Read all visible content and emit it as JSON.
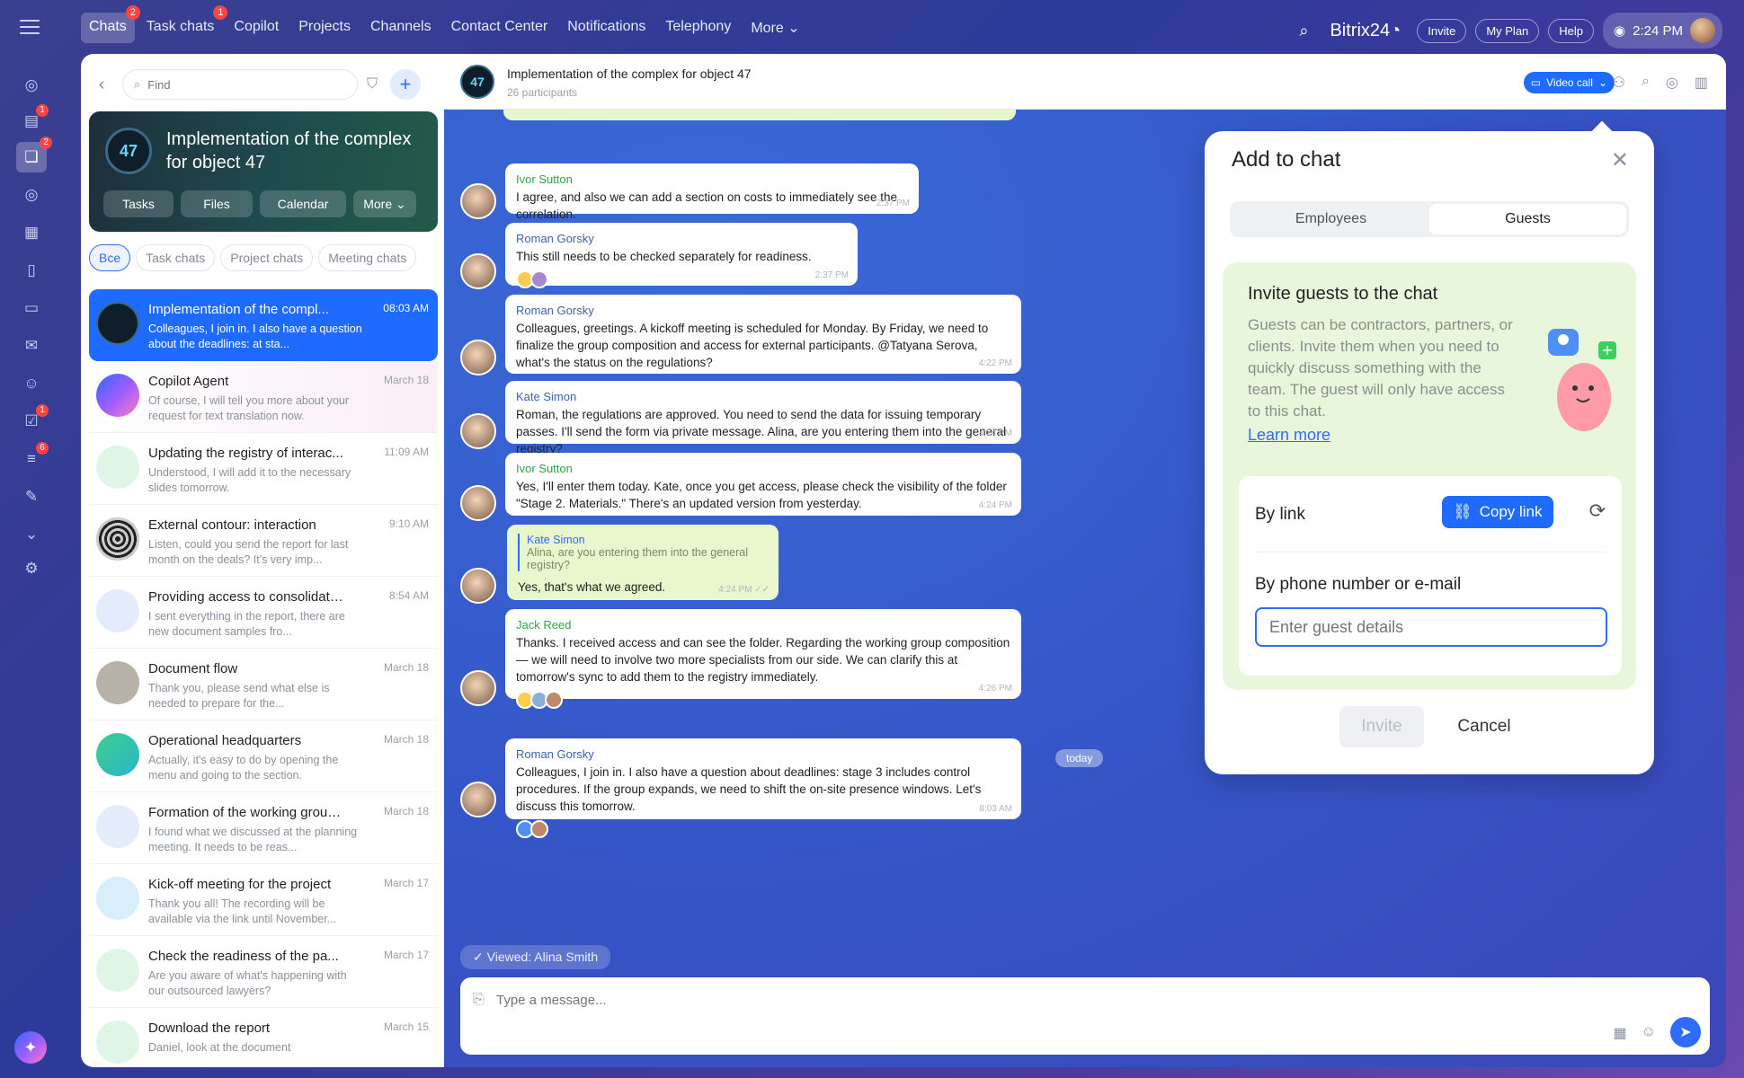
{
  "topbar": {
    "nav": [
      {
        "label": "Chats",
        "badge": "2"
      },
      {
        "label": "Task chats",
        "badge": "1"
      },
      {
        "label": "Copilot",
        "badge": ""
      },
      {
        "label": "Projects",
        "badge": ""
      },
      {
        "label": "Channels",
        "badge": ""
      },
      {
        "label": "Contact Center",
        "badge": ""
      },
      {
        "label": "Notifications",
        "badge": ""
      },
      {
        "label": "Telephony",
        "badge": ""
      },
      {
        "label": "More ⌄",
        "badge": ""
      }
    ],
    "brand": "Bitrix24",
    "invite": "Invite",
    "my_plan": "My Plan",
    "help": "Help",
    "time": "2:24 PM"
  },
  "rail": {
    "badges": [
      "1",
      "2",
      "1",
      "6"
    ]
  },
  "left": {
    "search_placeholder": "Find",
    "hero_title": "Implementation of the complex for object 47",
    "hero_buttons": [
      "Tasks",
      "Files",
      "Calendar",
      "More ⌄"
    ],
    "filters": [
      "Все",
      "Task chats",
      "Project chats",
      "Meeting chats"
    ],
    "chats": [
      {
        "name": "Implementation of the compl...",
        "time": "08:03 AM",
        "preview": "Colleagues, I join in. I also have a question about the deadlines: at sta..."
      },
      {
        "name": "Copilot Agent",
        "time": "March 18",
        "preview": "Of course, I will tell you more about your request for text translation now."
      },
      {
        "name": "Updating the registry of interac...",
        "time": "11:09 AM",
        "preview": "Understood, I will add it to the necessary slides tomorrow."
      },
      {
        "name": "External contour: interaction",
        "time": "9:10 AM",
        "preview": "Listen, could you send the report for last month on the deals? It's very imp..."
      },
      {
        "name": "Providing access to consolidate...",
        "time": "8:54 AM",
        "preview": "I sent everything in the report, there are new document samples fro..."
      },
      {
        "name": "Document flow",
        "time": "March 18",
        "preview": "Thank you, please send what else is needed to prepare for the..."
      },
      {
        "name": "Operational headquarters",
        "time": "March 18",
        "preview": "Actually, it's easy to do by opening the menu and going to the section."
      },
      {
        "name": "Formation of the working group...",
        "time": "March 18",
        "preview": "I found what we discussed at the planning meeting. It needs to be reas..."
      },
      {
        "name": "Kick-off meeting for the project",
        "time": "March 17",
        "preview": "Thank you all! The recording will be available via the link until November..."
      },
      {
        "name": "Check the readiness of the pa...",
        "time": "March 17",
        "preview": "Are you aware of what's happening with our outsourced lawyers?"
      },
      {
        "name": "Download the report",
        "time": "March 15",
        "preview": "Daniel, look at the document"
      }
    ]
  },
  "chat": {
    "title": "Implementation of the complex for object 47",
    "participants": "26 participants",
    "video_call": "Video call",
    "messages": [
      {
        "author": "Ivor Sutton",
        "text": "I agree, and also we can add a section on costs to immediately see the correlation.",
        "time": "2:37 PM"
      },
      {
        "author": "Roman Gorsky",
        "text": "This still needs to be checked separately for readiness.",
        "time": "2:37 PM"
      },
      {
        "author": "Roman Gorsky",
        "text": "Colleagues, greetings. A kickoff meeting is scheduled for Monday. By Friday, we need to finalize the group composition and access for external participants. @Tatyana Serova, what's the status on the regulations?",
        "time": "4:22 PM"
      },
      {
        "author": "Kate Simon",
        "text": "Roman, the regulations are approved. You need to send the data for issuing temporary passes. I'll send the form via private message. Alina, are you entering them into the general registry?",
        "time": "4:24 PM"
      },
      {
        "author": "Ivor Sutton",
        "text": "Yes, I'll enter them today. Kate, once you get access, please check the visibility of the folder \"Stage 2. Materials.\" There's an updated version from yesterday.",
        "time": "4:24 PM"
      },
      {
        "quote_author": "Kate Simon",
        "quote_text": "Alina, are you entering them into the general registry?",
        "text": "Yes, that's what we agreed.",
        "time": "4:24 PM"
      },
      {
        "author": "Jack Reed",
        "text": "Thanks. I received access and can see the folder. Regarding the working group composition — we will need to involve two more specialists from our side. We can clarify this at tomorrow's sync to add them to the registry immediately.",
        "time": "4:26 PM"
      },
      {
        "author": "Roman Gorsky",
        "text": "Colleagues, I join in. I also have a question about deadlines: stage 3 includes control procedures. If the group expands, we need to shift the on-site presence windows. Let's discuss this tomorrow.",
        "time": "8:03 AM"
      }
    ],
    "today": "today",
    "viewed": "Viewed: Alina Smith",
    "composer_placeholder": "Type a message..."
  },
  "dialog": {
    "title": "Add to chat",
    "tabs": [
      "Employees",
      "Guests"
    ],
    "invite_title": "Invite guests to the chat",
    "invite_desc": "Guests can be contractors, partners, or clients. Invite them when you need to quickly discuss something with the team. The guest will only have access to this chat.",
    "learn_more": "Learn more",
    "by_link": "By link",
    "copy_link": "Copy link",
    "by_phone": "By phone number or e-mail",
    "guest_placeholder": "Enter guest details",
    "invite_btn": "Invite",
    "cancel_btn": "Cancel"
  }
}
